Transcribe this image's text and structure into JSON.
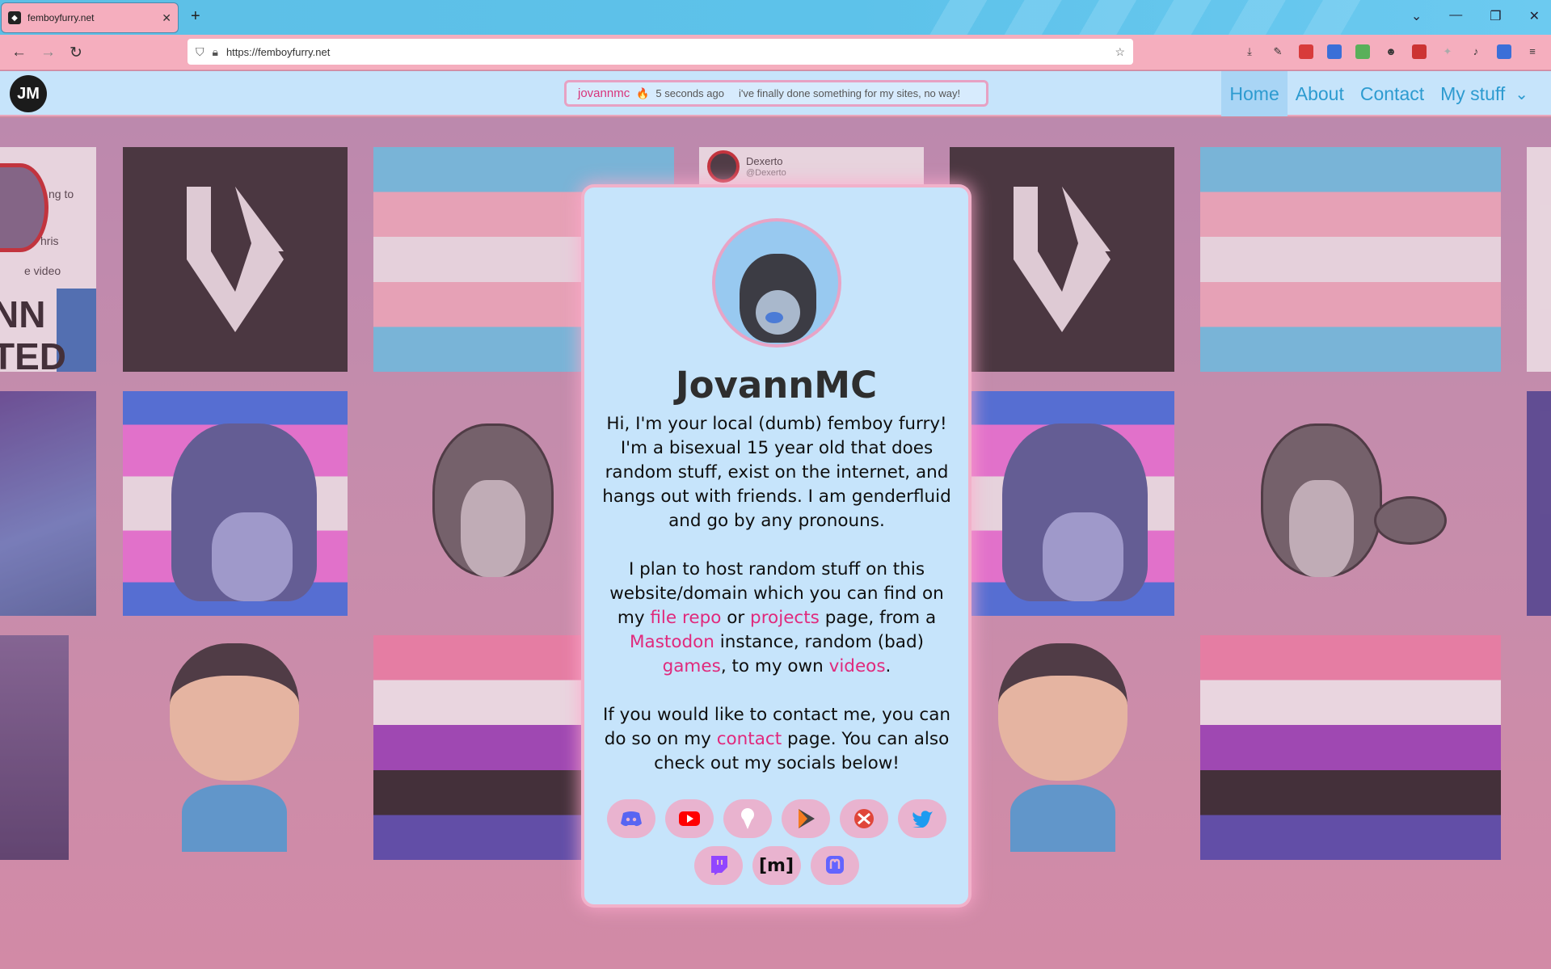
{
  "browser": {
    "tab_title": "femboyfurry.net",
    "new_tab": "+",
    "close_tab": "✕",
    "url": "https://femboyfurry.net",
    "window_controls": [
      "⌄",
      "—",
      "❐",
      "✕"
    ]
  },
  "site": {
    "logo_text": "JM",
    "status": {
      "user": "jovannmc",
      "emoji": "🔥",
      "time": "5 seconds ago",
      "message": "i've finally done something for my sites, no way!"
    },
    "nav": {
      "home": "Home",
      "about": "About",
      "contact": "Contact",
      "my_stuff": "My stuff"
    }
  },
  "card": {
    "name": "JovannMC",
    "p1": "Hi, I'm your local (dumb) femboy furry! I'm a bisexual 15 year old that does random stuff, exist on the internet, and hangs out with friends. I am genderfluid and go by any pronouns.",
    "p2_a": "I plan to host random stuff on this website/domain which you can find on my ",
    "link_file_repo": "file repo",
    "p2_b": " or ",
    "link_projects": "projects",
    "p2_c": " page, from a ",
    "link_mastodon": "Mastodon",
    "p2_d": " instance, random (bad) ",
    "link_games": "games",
    "p2_e": ", to my own ",
    "link_videos": "videos",
    "p2_f": ".",
    "p3_a": "If you would like to contact me, you can do so on my ",
    "link_contact": "contact",
    "p3_b": " page. You can also check out my socials below!",
    "matrix_label": "[m]"
  },
  "background_text": {
    "shot_text_1": "ng to",
    "shot_text_2": "hris",
    "shot_text_3": "e video",
    "shot_text_4": "NN",
    "shot_text_5": "TED",
    "shot_handle": "Dexerto",
    "shot_handle2": "@Dexerto"
  },
  "colors": {
    "accent_pink": "#e0297c",
    "nav_blue": "#2d9bd0",
    "card_bg": "#c6e4fb"
  }
}
